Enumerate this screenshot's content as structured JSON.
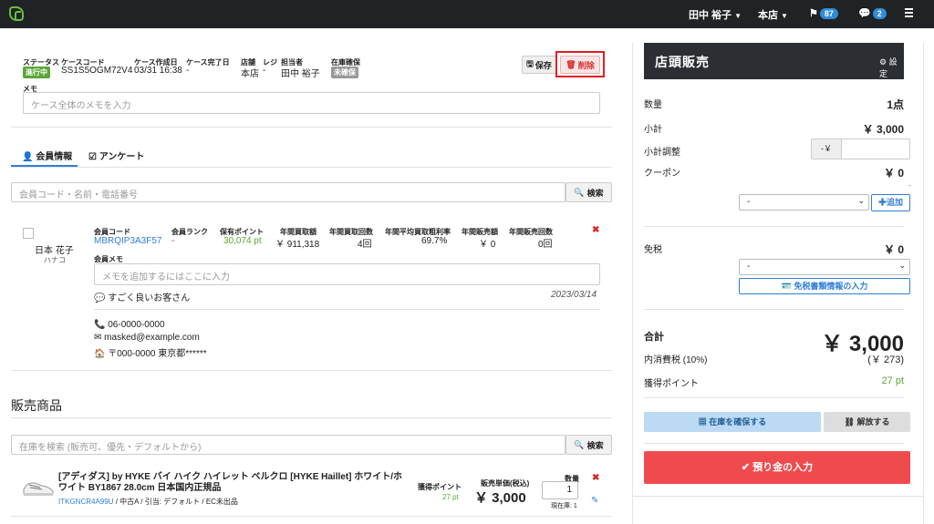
{
  "topbar": {
    "user": "田中 裕子",
    "store": "本店",
    "flag_count": "87",
    "chat_count": "2"
  },
  "case": {
    "status_label": "ステータス",
    "status": "進行中",
    "code_label": "ケースコード",
    "code": "SS1S5OGM72V4",
    "created_label": "ケース作成日",
    "created": "03/31 16:38",
    "completed_label": "ケース完了日",
    "completed": "-",
    "store_label": "店舗",
    "store": "本店",
    "register_label": "レジ",
    "register": "-",
    "staff_label": "担当者",
    "staff": "田中 裕子",
    "stock_label": "在庫確保",
    "stock": "未確保",
    "save": "保存",
    "delete": "削除",
    "memo_label": "メモ",
    "memo_placeholder": "ケース全体のメモを入力"
  },
  "tabs": {
    "member": "会員情報",
    "survey": "アンケート"
  },
  "member_search": {
    "placeholder": "会員コード・名前・電話番号",
    "button": "検索"
  },
  "member": {
    "name": "日本 花子",
    "kana": "ハナコ",
    "code_label": "会員コード",
    "code": "MBRQIP3A3F57",
    "rank_label": "会員ランク",
    "rank": "-",
    "points_label": "保有ポイント",
    "points": "30,074 pt",
    "annual_buy_label": "年間買取額",
    "annual_buy": "￥ 911,318",
    "annual_buy_count_label": "年間買取回数",
    "annual_buy_count": "4回",
    "margin_label": "年間平均買取粗利率",
    "margin": "69.7%",
    "annual_sales_label": "年間販売額",
    "annual_sales": "￥ 0",
    "annual_sales_count_label": "年間販売回数",
    "annual_sales_count": "0回",
    "memo_label": "会員メモ",
    "memo_placeholder": "メモを追加するにはここに入力",
    "comment": "すごく良いお客さん",
    "comment_date": "2023/03/14",
    "phone": "06-0000-0000",
    "email": "masked@example.com",
    "address": "〒000-0000 東京都******"
  },
  "sales": {
    "title": "販売商品",
    "search_placeholder": "在庫を検索 (販売可、優先・デフォルトから)",
    "search_button": "検索"
  },
  "product": {
    "name": "[アディダス] by HYKE バイ ハイク ハイレット ベルクロ [HYKE Haillet] ホワイト/ホワイト BY1867 28.0cm 日本国内正規品",
    "code": "ITKGNCR4A99U",
    "meta": "中古A / 引当: デフォルト / EC未出品",
    "points_label": "獲得ポイント",
    "points": "27 pt",
    "price_label": "販売単価(税込)",
    "price": "￥ 3,000",
    "qty_label": "数量",
    "qty": "1",
    "stock_note": "現在庫: 1"
  },
  "pos": {
    "title": "店頭販売",
    "settings": "設定",
    "qty_label": "数量",
    "qty": "1点",
    "subtotal_label": "小計",
    "subtotal": "￥ 3,000",
    "adjust_label": "小計調整",
    "adjust_prefix": "-￥",
    "coupon_label": "クーポン",
    "coupon": "￥ 0",
    "coupon_dash": "-",
    "coupon_select": "-",
    "add": "追加",
    "taxfree_label": "免税",
    "taxfree": "￥ 0",
    "taxfree_select": "-",
    "taxfree_button": "免税書類情報の入力",
    "total_label": "合計",
    "total": "￥ 3,000",
    "tax_label": "内消費税 (10%)",
    "tax": "(￥ 273)",
    "earn_label": "獲得ポイント",
    "earn": "27 pt",
    "reserve": "在庫を確保する",
    "release": "解放する",
    "deposit": "預り金の入力"
  },
  "colors": {
    "status_green": "#5aa637",
    "stock_gray": "#999999",
    "delete_red": "#d9292b",
    "deposit_red": "#ef4b4f",
    "link_blue": "#2f7ed8"
  }
}
